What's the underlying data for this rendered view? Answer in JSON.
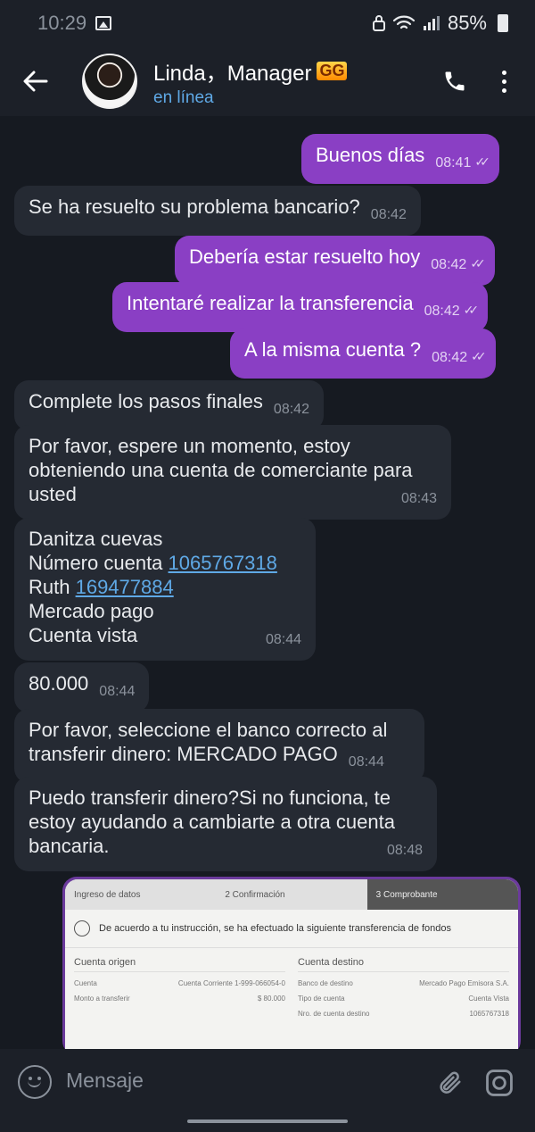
{
  "status_bar": {
    "time": "10:29",
    "battery": "85%"
  },
  "header": {
    "name": "Linda，Manager",
    "badge": "GG",
    "status": "en línea"
  },
  "messages": [
    {
      "dir": "out",
      "text": "Buenos  días",
      "time": "08:41"
    },
    {
      "dir": "in",
      "text": "Se ha resuelto su problema bancario?",
      "time": "08:42"
    },
    {
      "dir": "out",
      "text": "Debería estar resuelto  hoy",
      "time": "08:42"
    },
    {
      "dir": "out",
      "text": "Intentaré realizar  la transferencia",
      "time": "08:42"
    },
    {
      "dir": "out",
      "text": "A la misma  cuenta ?",
      "time": "08:42"
    },
    {
      "dir": "in",
      "text": "Complete los pasos finales",
      "time": "08:42"
    },
    {
      "dir": "in",
      "lines": [
        "Por favor, espere un momento, estoy",
        "obteniendo una cuenta de comerciante para",
        "usted"
      ],
      "time": "08:43"
    },
    {
      "dir": "in",
      "line1": "Danitza cuevas",
      "line2_prefix": "Número cuenta ",
      "line2_link": "1065767318",
      "line3_prefix": "Ruth ",
      "line3_link": "169477884",
      "line4": "Mercado pago",
      "line5": "Cuenta vista",
      "time": "08:44"
    },
    {
      "dir": "in",
      "text": "80.000",
      "time": "08:44"
    },
    {
      "dir": "in",
      "lines": [
        "Por favor, seleccione el banco correcto al",
        "transferir dinero: MERCADO PAGO"
      ],
      "time": "08:44"
    },
    {
      "dir": "in",
      "lines": [
        "Puedo transferir dinero?Si no funciona, te",
        "estoy ayudando a cambiarte a otra cuenta",
        "bancaria."
      ],
      "time": "08:48"
    }
  ],
  "attachment": {
    "steps": [
      "Ingreso de datos",
      "2  Confirmación",
      "3  Comprobante"
    ],
    "notice": "De acuerdo a tu instrucción, se ha efectuado la siguiente transferencia de fondos",
    "origin_title": "Cuenta origen",
    "origin_rows": [
      [
        "Cuenta",
        "Cuenta Corriente 1-999-066054-0"
      ],
      [
        "Monto a transferir",
        "$ 80.000"
      ]
    ],
    "dest_title": "Cuenta destino",
    "dest_rows": [
      [
        "Banco de destino",
        "Mercado Pago Emisora S.A."
      ],
      [
        "Tipo de cuenta",
        "Cuenta Vista"
      ],
      [
        "Nro. de cuenta destino",
        "1065767318"
      ]
    ]
  },
  "input": {
    "placeholder": "Mensaje"
  },
  "colors": {
    "outgoing": "#8a3fc4",
    "incoming": "#252a33",
    "background": "#161a21",
    "link": "#5fa9e6"
  }
}
